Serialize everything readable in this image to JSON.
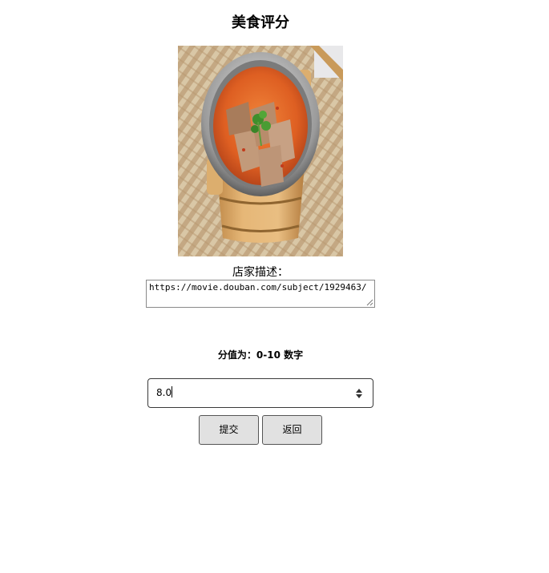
{
  "page": {
    "title": "美食评分"
  },
  "photo": {
    "subject": "hot-pot-stew-icon",
    "alt": "food"
  },
  "form": {
    "description_label": "店家描述：",
    "description_value": "https://movie.douban.com/subject/1929463/",
    "hint": "分值为：0-10 数字",
    "score_value": "8.0",
    "submit_label": "提交",
    "back_label": "返回"
  },
  "colors": {
    "button_bg": "#e1e1e1",
    "border": "#3a3a3a",
    "soup": "#e06a2a"
  }
}
